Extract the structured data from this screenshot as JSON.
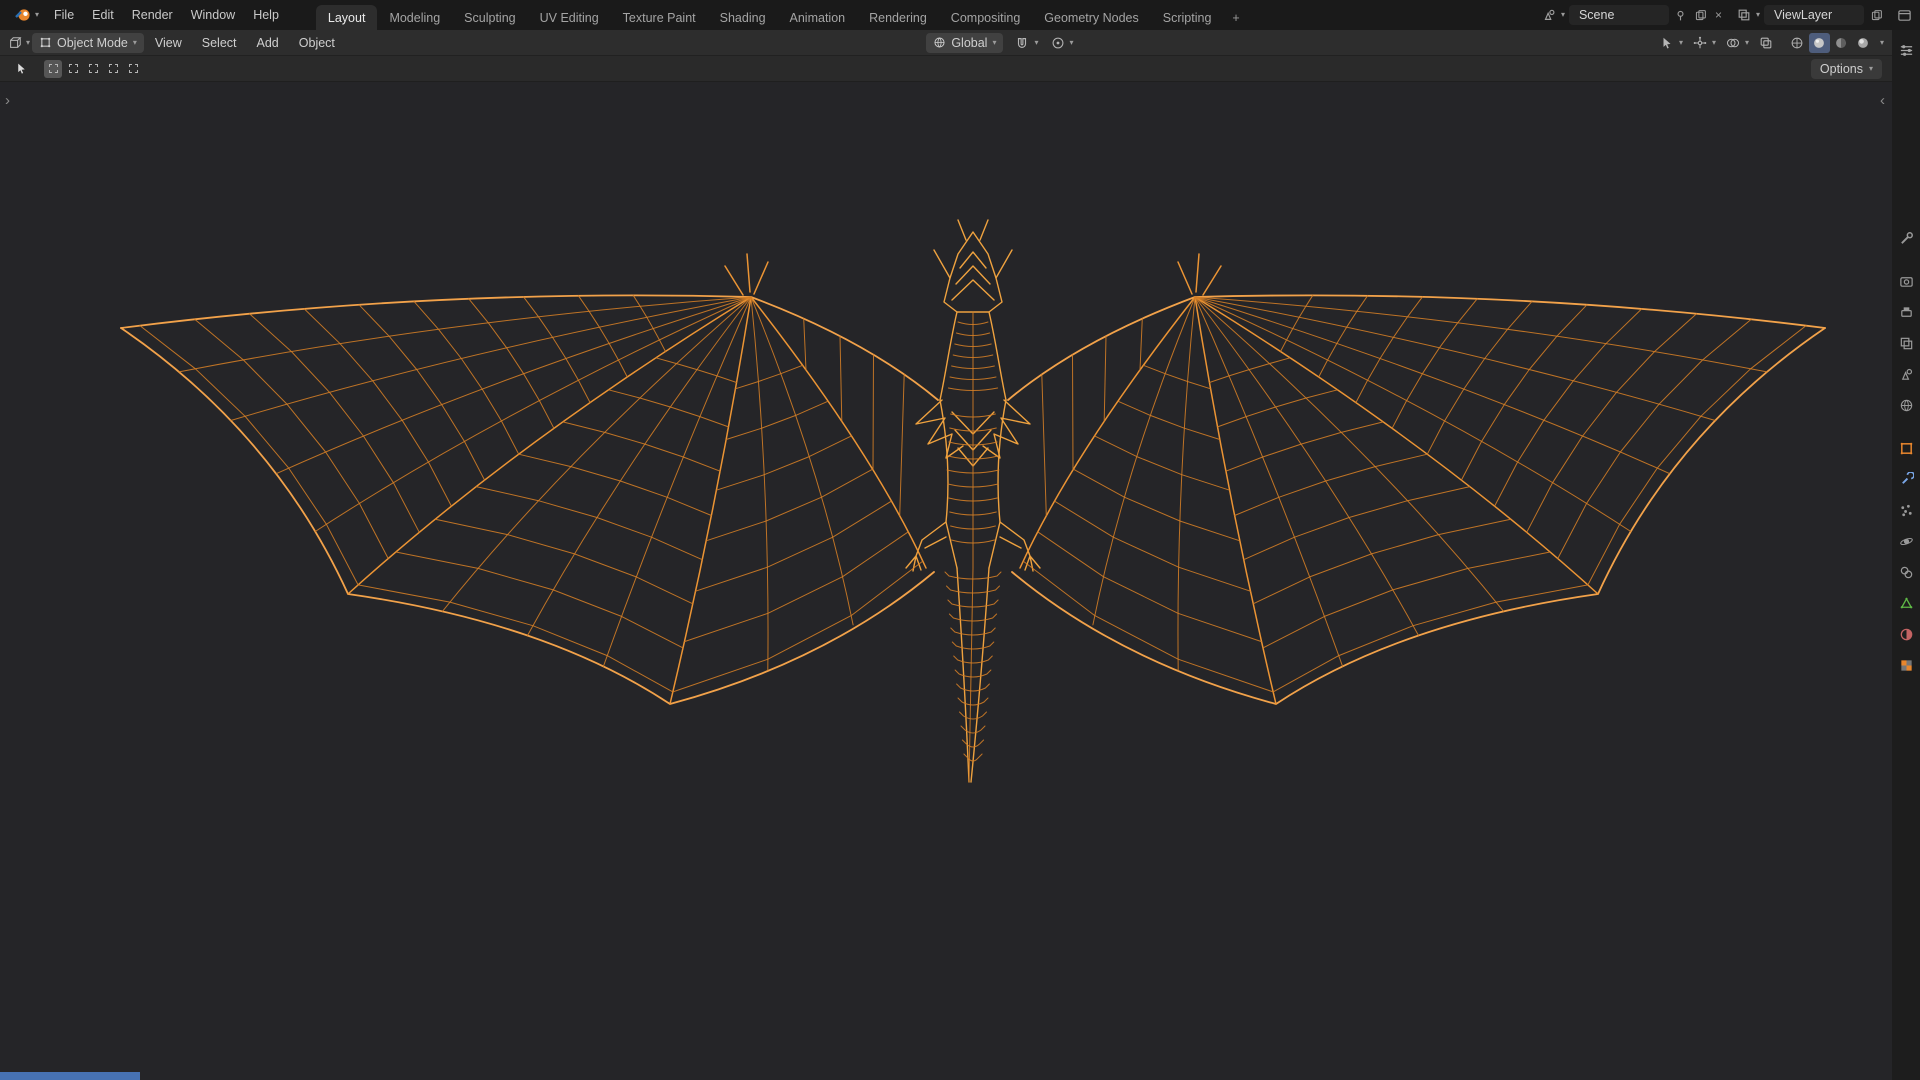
{
  "app_title": "Blender",
  "glyphs": {
    "dropdown": "▾",
    "close": "×",
    "add": "+",
    "expand_left": "‹",
    "expand_right": "›"
  },
  "colors": {
    "wire": "#d47e26",
    "wire_bright": "#f2a24a",
    "accent_orange": "#e8862d",
    "selection_blue": "#4772b3",
    "viewport_bg": "#252528",
    "topbar_bg": "#1a1a1a",
    "header_bg": "#2d2d2d"
  },
  "topbar": {
    "menus": [
      "File",
      "Edit",
      "Render",
      "Window",
      "Help"
    ],
    "tabs": [
      {
        "label": "Layout",
        "active": true
      },
      {
        "label": "Modeling"
      },
      {
        "label": "Sculpting"
      },
      {
        "label": "UV Editing"
      },
      {
        "label": "Texture Paint"
      },
      {
        "label": "Shading"
      },
      {
        "label": "Animation"
      },
      {
        "label": "Rendering"
      },
      {
        "label": "Compositing"
      },
      {
        "label": "Geometry Nodes"
      },
      {
        "label": "Scripting"
      }
    ],
    "scene_selector": {
      "value": "Scene"
    },
    "view_layer_selector": {
      "value": "ViewLayer"
    }
  },
  "viewport": {
    "header": {
      "mode": "Object Mode",
      "menus": [
        "View",
        "Select",
        "Add",
        "Object"
      ],
      "orientation": "Global"
    },
    "tool_settings": {
      "options_label": "Options"
    }
  },
  "properties_tabs": [
    "tool",
    "render",
    "output",
    "view-layer",
    "scene",
    "world",
    "object",
    "modifiers",
    "particles",
    "physics",
    "constraints",
    "object-data",
    "material",
    "texture"
  ]
}
